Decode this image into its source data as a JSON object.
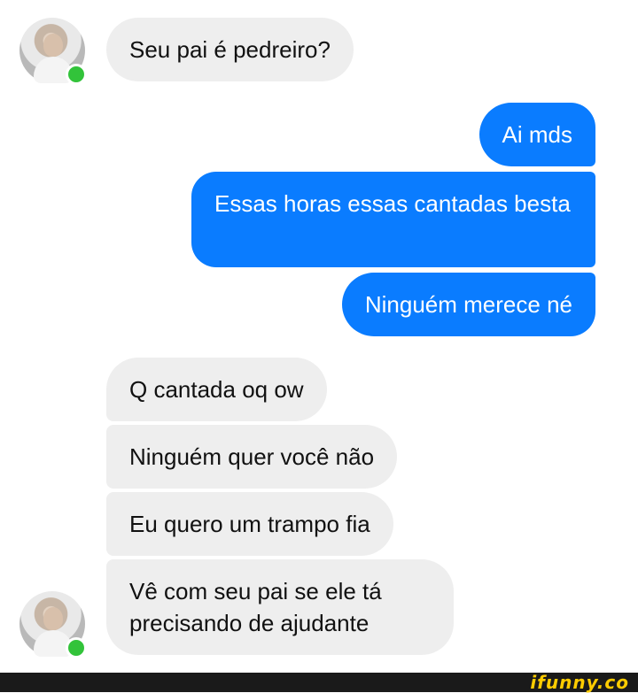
{
  "messages": [
    {
      "side": "in",
      "text": "Seu pai é pedreiro?"
    },
    {
      "side": "out",
      "text": "Ai mds"
    },
    {
      "side": "out",
      "text": "Essas horas essas cantadas besta"
    },
    {
      "side": "out",
      "text": "Ninguém merece né"
    },
    {
      "side": "in",
      "text": "Q cantada oq ow"
    },
    {
      "side": "in",
      "text": "Ninguém quer você não"
    },
    {
      "side": "in",
      "text": "Eu quero um trampo fia"
    },
    {
      "side": "in",
      "text": "Vê com seu pai se ele tá precisando de ajudante"
    }
  ],
  "colors": {
    "outgoing": "#0a7cff",
    "incoming": "#eeeeee",
    "presence": "#32c33a"
  },
  "watermark": "ifunny.co"
}
